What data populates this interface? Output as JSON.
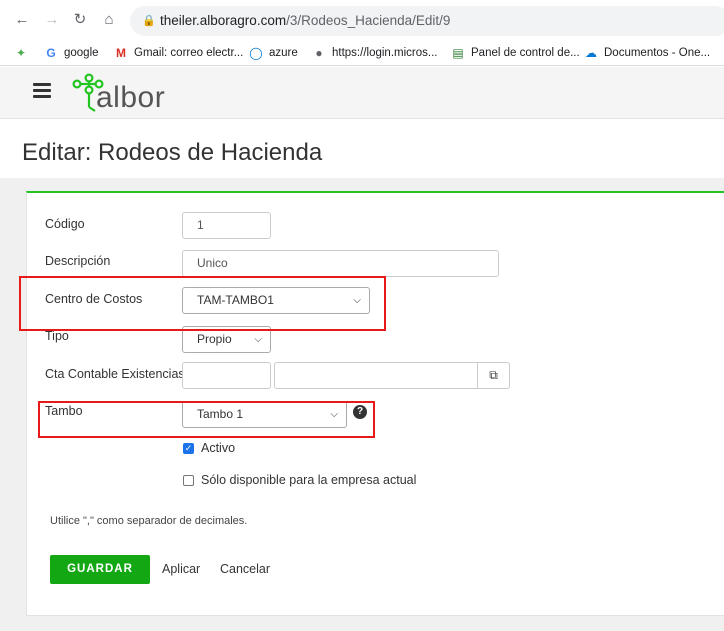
{
  "browser": {
    "url_host": "theiler.alboragro.com",
    "url_path": "/3/Rodeos_Hacienda/Edit/9",
    "bookmarks": [
      {
        "label": "",
        "icon": "plant-icon"
      },
      {
        "label": "google",
        "icon": "google-icon"
      },
      {
        "label": "Gmail: correo electr...",
        "icon": "gmail-icon"
      },
      {
        "label": "azure",
        "icon": "azure-icon"
      },
      {
        "label": "https://login.micros...",
        "icon": "globe-icon"
      },
      {
        "label": "Panel de control de...",
        "icon": "document-icon"
      },
      {
        "label": "Documentos - One...",
        "icon": "cloud-icon"
      }
    ]
  },
  "app": {
    "logo_text": "albor",
    "page_title": "Editar: Rodeos de Hacienda"
  },
  "form": {
    "codigo": {
      "label": "Código",
      "value": "1"
    },
    "descripcion": {
      "label": "Descripción",
      "value": "Unico"
    },
    "centro_costos": {
      "label": "Centro de Costos",
      "value": "TAM-TAMBO1"
    },
    "tipo": {
      "label": "Tipo",
      "value": "Propio"
    },
    "cta_contable": {
      "label": "Cta Contable Existencias",
      "value1": "",
      "value2": ""
    },
    "tambo": {
      "label": "Tambo",
      "value": "Tambo 1"
    },
    "activo": {
      "label": "Activo",
      "checked": true
    },
    "solo_disponible": {
      "label": "Sólo disponible para la empresa actual",
      "checked": false
    },
    "note": "Utilice \",\" como separador de decimales."
  },
  "actions": {
    "save": "GUARDAR",
    "apply": "Aplicar",
    "cancel": "Cancelar"
  },
  "colors": {
    "accent_green": "#22c422",
    "save_button": "#13a813",
    "highlight_red": "#e81919"
  }
}
